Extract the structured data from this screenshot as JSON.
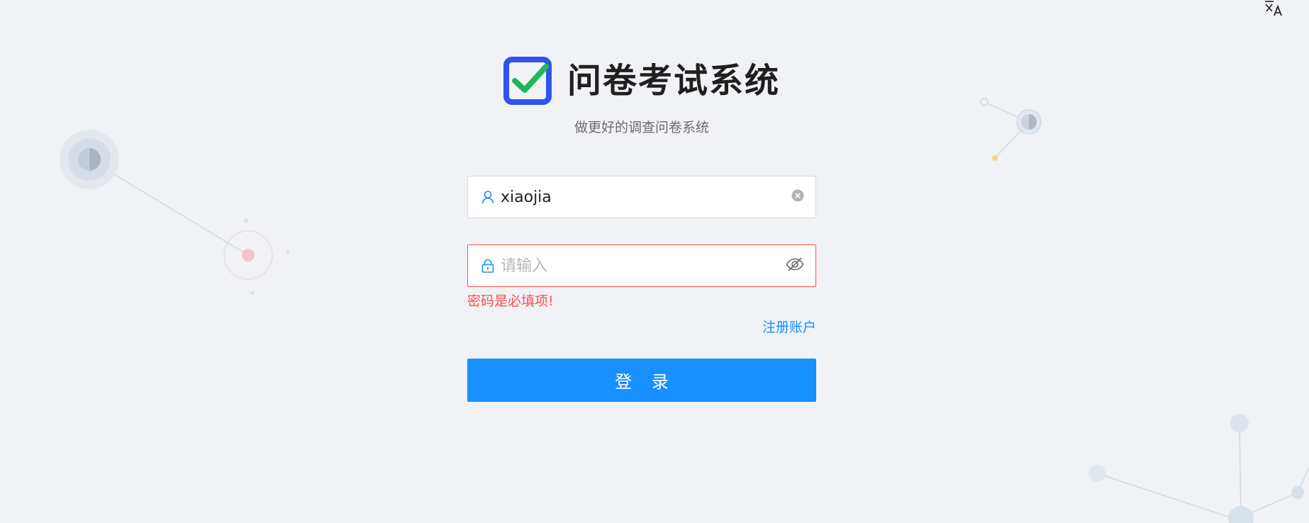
{
  "app": {
    "title": "问卷考试系统",
    "subtitle": "做更好的调查问卷系统"
  },
  "icons": {
    "language": "translate-icon",
    "logo": "checkbox-logo-icon",
    "username_prefix": "user-icon",
    "username_suffix": "clear-icon",
    "password_prefix": "lock-icon",
    "password_suffix": "eye-invisible-icon"
  },
  "form": {
    "username": {
      "value": "xiaojia"
    },
    "password": {
      "value": "",
      "placeholder": "请输入",
      "error": "密码是必填项!"
    },
    "register_label": "注册账户",
    "submit_label": "登 录"
  },
  "colors": {
    "primary": "#1890ff",
    "error": "#ff4d4f",
    "logo_blue": "#2f54eb",
    "logo_check": "#1fb856",
    "background": "#f0f2f5"
  }
}
